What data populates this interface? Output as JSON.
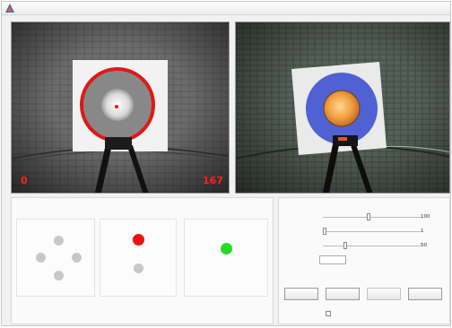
{
  "window": {
    "title": "",
    "controls_label": "",
    "icon": "app-icon"
  },
  "camera": {
    "left_count": "0",
    "right_count": "167",
    "colors": {
      "ring": "#e01818",
      "blob_inner": "#f4a840",
      "blob_outer": "#3f52d0",
      "count_text": "#ff2020"
    }
  },
  "tracking": {
    "heading": "",
    "groups": [
      {
        "label": "",
        "value": ""
      },
      {
        "label": "",
        "value": ""
      },
      {
        "label": "",
        "value": ""
      }
    ],
    "indicator_colors": {
      "red": "#ee1111",
      "green": "#22dd22",
      "idle": "#c8c8c8"
    },
    "status": [
      {
        "label": "",
        "value": ""
      },
      {
        "label": "",
        "value": ""
      },
      {
        "label": "",
        "value": ""
      }
    ]
  },
  "params": {
    "heading": "",
    "rows": [
      {
        "label": "",
        "value": "100"
      },
      {
        "label": "",
        "value": "1"
      },
      {
        "label": "",
        "value": "50"
      }
    ],
    "center_label": "",
    "center_value": "",
    "buttons": [
      {
        "label": "",
        "enabled": true
      },
      {
        "label": "",
        "enabled": true
      },
      {
        "label": "",
        "enabled": false
      },
      {
        "label": "",
        "enabled": true
      }
    ],
    "checkbox_label": ""
  }
}
